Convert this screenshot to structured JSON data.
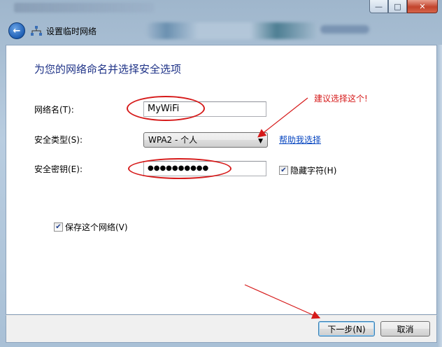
{
  "window": {
    "min_symbol": "—",
    "max_symbol": "□",
    "close_symbol": "✕"
  },
  "header": {
    "title": "设置临时网络",
    "back_icon": "back-arrow-icon",
    "wizard_icon": "network-icon"
  },
  "page": {
    "heading": "为您的网络命名并选择安全选项"
  },
  "form": {
    "network_name": {
      "label": "网络名(T):",
      "value": "MyWiFi"
    },
    "security_type": {
      "label": "安全类型(S):",
      "value": "WPA2 - 个人",
      "help_link": "帮助我选择"
    },
    "security_key": {
      "label": "安全密钥(E):",
      "value": "●●●●●●●●●●",
      "hide_chars_label": "隐藏字符(H)",
      "hide_chars_checked": true
    },
    "save_network": {
      "label": "保存这个网络(V)",
      "checked": true
    }
  },
  "annotation": {
    "text": "建议选择这个!",
    "color": "#d61a1a"
  },
  "footer": {
    "next_label": "下一步(N)",
    "cancel_label": "取消"
  },
  "colors": {
    "heading": "#1e3287",
    "link": "#0645c0",
    "annotation": "#d61a1a"
  }
}
